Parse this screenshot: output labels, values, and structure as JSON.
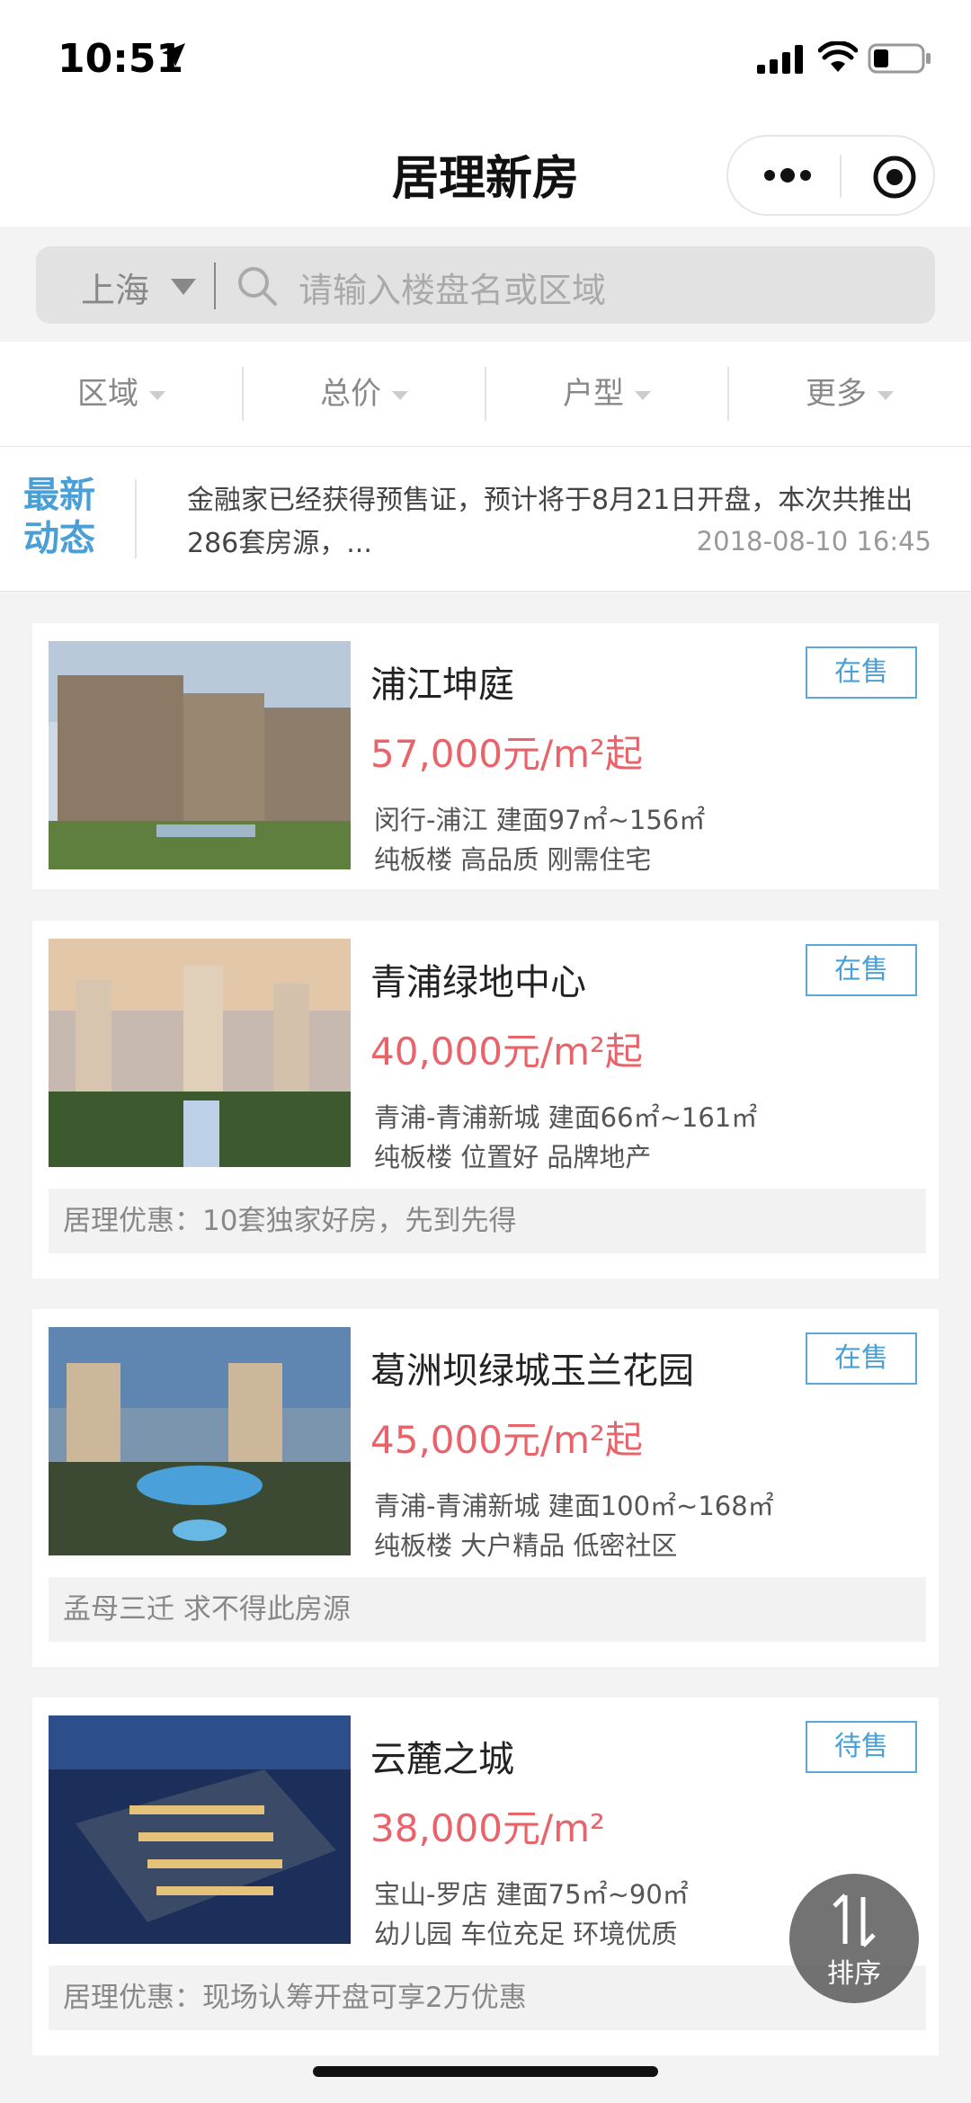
{
  "status_bar": {
    "time": "10:51"
  },
  "nav": {
    "title": "居理新房"
  },
  "search": {
    "city": "上海",
    "placeholder": "请输入楼盘名或区域"
  },
  "filters": [
    "区域",
    "总价",
    "户型",
    "更多"
  ],
  "news": {
    "tag": "最新动态",
    "text": "金融家已经获得预售证，预计将于8月21日开盘，本次共推出286套房源，...",
    "date": "2018-08-10 16:45"
  },
  "listings": [
    {
      "name": "浦江坤庭",
      "status": "在售",
      "price": "57,000元/m²起",
      "location": "闵行-浦江 建面97㎡~156㎡",
      "tags": "纯板楼 高品质 刚需住宅",
      "promo": ""
    },
    {
      "name": "青浦绿地中心",
      "status": "在售",
      "price": "40,000元/m²起",
      "location": "青浦-青浦新城 建面66㎡~161㎡",
      "tags": "纯板楼 位置好 品牌地产",
      "promo": "居理优惠：10套独家好房，先到先得"
    },
    {
      "name": "葛洲坝绿城玉兰花园",
      "status": "在售",
      "price": "45,000元/m²起",
      "location": "青浦-青浦新城 建面100㎡~168㎡",
      "tags": "纯板楼 大户精品 低密社区",
      "promo": "孟母三迁 求不得此房源"
    },
    {
      "name": "云麓之城",
      "status": "待售",
      "price": "38,000元/m²",
      "location": "宝山-罗店 建面75㎡~90㎡",
      "tags": "幼儿园 车位充足 环境优质",
      "promo": "居理优惠：现场认筹开盘可享2万优惠"
    }
  ],
  "sort_button": {
    "label": "排序"
  },
  "colors": {
    "accent": "#4a9fd5",
    "price": "#e8636a"
  }
}
